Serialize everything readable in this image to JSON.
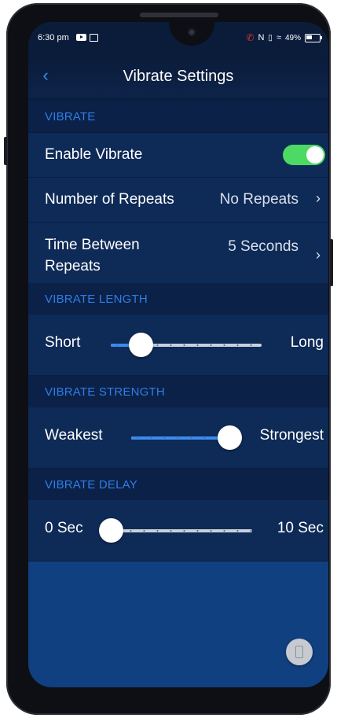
{
  "status_bar": {
    "time": "6:30 pm",
    "battery": "49%",
    "icons": [
      "youtube-icon",
      "image-icon",
      "call-icon",
      "nfc-icon",
      "vibrate-icon",
      "wifi-icon",
      "battery-icon"
    ]
  },
  "header": {
    "back_symbol": "‹",
    "title": "Vibrate Settings"
  },
  "sections": {
    "vibrate": "VIBRATE",
    "vibrate_length": "VIBRATE LENGTH",
    "vibrate_strength": "VIBRATE STRENGTH",
    "vibrate_delay": "VIBRATE DELAY"
  },
  "enable_vibrate": {
    "label": "Enable Vibrate",
    "on": true
  },
  "repeats": {
    "label": "Number of Repeats",
    "value": "No Repeats",
    "chevron": "›"
  },
  "time_between": {
    "label_line1": "Time Between",
    "label_line2": "Repeats",
    "value": "5 Seconds",
    "chevron": "›"
  },
  "length_slider": {
    "min_label": "Short",
    "max_label": "Long",
    "level": 0.2
  },
  "strength_slider": {
    "min_label": "Weakest",
    "max_label": "Strongest",
    "level": 1.0
  },
  "delay_slider": {
    "min_label": "0 Sec",
    "max_label": "10 Sec",
    "level": 0.0
  },
  "colors": {
    "accent": "#3a8cf0",
    "toggle_on": "#4cd964",
    "background": "#0e2a57"
  }
}
